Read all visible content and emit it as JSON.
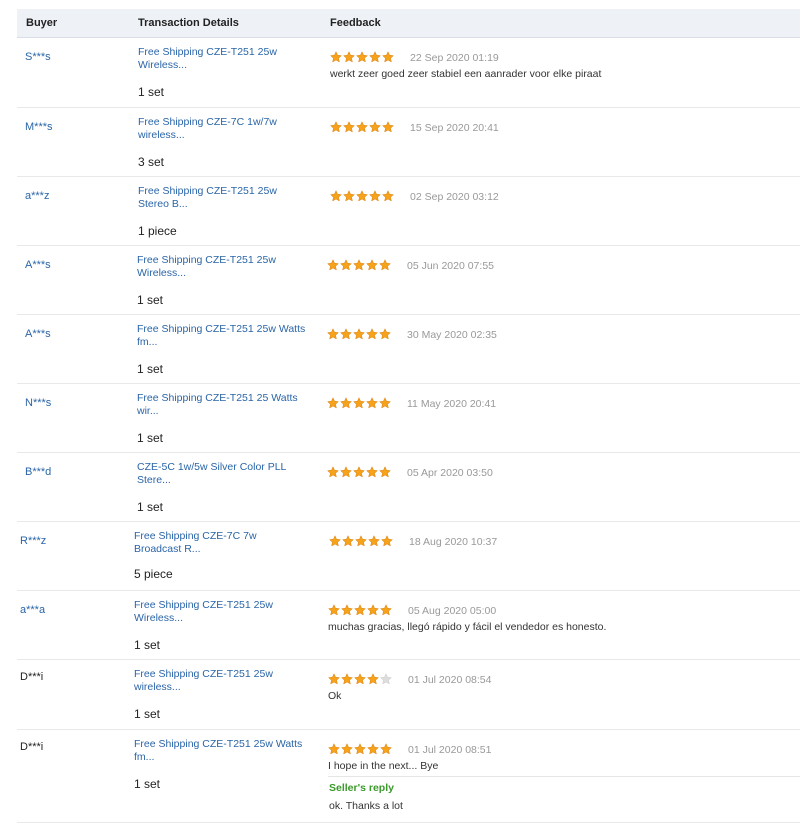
{
  "header": {
    "buyer": "Buyer",
    "details": "Transaction Details",
    "feedback": "Feedback"
  },
  "colors": {
    "link": "#2a65a8",
    "date": "#999999",
    "reply": "#3a9a2a",
    "star_on": "#f7a21b",
    "star_off": "#dddddd"
  },
  "icons": {
    "star": "star-icon"
  },
  "rows": [
    {
      "buyer": "S***s",
      "product": "Free Shipping CZE-T251 25w Wireless...",
      "qty": "1 set",
      "rating": 5,
      "date": "22 Sep 2020 01:19",
      "comment": "werkt zeer goed zeer stabiel een aanrader voor elke piraat"
    },
    {
      "buyer": "M***s",
      "product": "Free Shipping CZE-7C 1w/7w wireless...",
      "qty": "3 set",
      "rating": 5,
      "date": "15 Sep 2020 20:41",
      "comment": ""
    },
    {
      "buyer": "a***z",
      "product": "Free Shipping CZE-T251 25w Stereo B...",
      "qty": "1 piece",
      "rating": 5,
      "date": "02 Sep 2020 03:12",
      "comment": ""
    },
    {
      "buyer": "A***s",
      "product": "Free Shipping CZE-T251 25w Wireless...",
      "qty": "1 set",
      "rating": 5,
      "date": "05 Jun 2020 07:55",
      "comment": ""
    },
    {
      "buyer": "A***s",
      "product": "Free Shipping CZE-T251 25w Watts fm...",
      "qty": "1 set",
      "rating": 5,
      "date": "30 May 2020 02:35",
      "comment": ""
    },
    {
      "buyer": "N***s",
      "product": "Free Shipping CZE-T251 25 Watts wir...",
      "qty": "1 set",
      "rating": 5,
      "date": "11 May 2020 20:41",
      "comment": ""
    },
    {
      "buyer": "B***d",
      "product": "CZE-5C 1w/5w Silver Color PLL Stere...",
      "qty": "1 set",
      "rating": 5,
      "date": "05 Apr 2020 03:50",
      "comment": ""
    },
    {
      "buyer": "R***z",
      "product": "Free Shipping CZE-7C 7w Broadcast R...",
      "qty": "5 piece",
      "rating": 5,
      "date": "18 Aug 2020 10:37",
      "comment": ""
    },
    {
      "buyer": "a***a",
      "product": "Free Shipping CZE-T251 25w Wireless...",
      "qty": "1 set",
      "rating": 5,
      "date": "05 Aug 2020 05:00",
      "comment": "muchas gracias, llegó rápido y fácil el vendedor es honesto."
    },
    {
      "buyer": "D***i",
      "product": "Free Shipping CZE-T251 25w wireless...",
      "qty": "1 set",
      "rating": 4,
      "date": "01 Jul 2020 08:54",
      "comment": "Ok"
    },
    {
      "buyer": "D***i",
      "product": "Free Shipping CZE-T251 25w Watts fm...",
      "qty": "1 set",
      "rating": 5,
      "date": "01 Jul 2020 08:51",
      "comment": "I hope in the next... Bye",
      "reply_label": "Seller's reply",
      "reply": "ok. Thanks a lot"
    }
  ]
}
